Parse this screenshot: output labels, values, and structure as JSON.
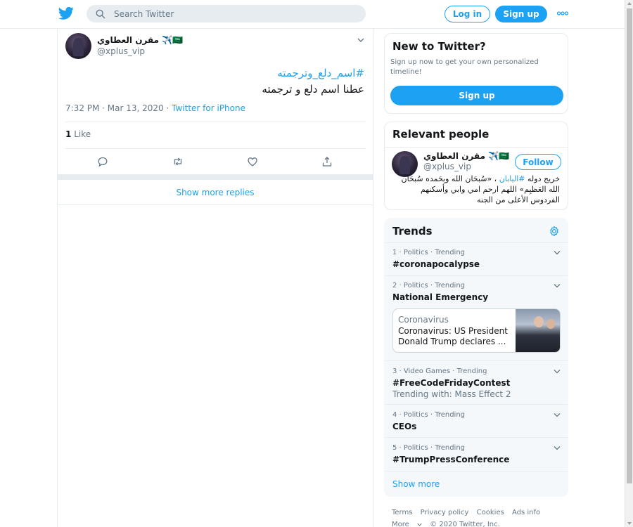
{
  "topbar": {
    "search_placeholder": "Search Twitter",
    "login_label": "Log in",
    "signup_label": "Sign up",
    "logo_icon": "twitter-bird-icon",
    "more_icon": "more-dots-icon"
  },
  "tweet": {
    "author_name": "مقرن العطاوي ✈️🇸🇦",
    "author_handle": "@xplus_vip",
    "hashtag": "#اسم_دلع_وترجمته",
    "text": "عطنا اسم دلع و ترجمته",
    "time": "7:32 PM · Mar 13, 2020",
    "separator": " · ",
    "source": "Twitter for iPhone",
    "likes_count": "1",
    "likes_label": "Like"
  },
  "replies": {
    "show_more_label": "Show more replies"
  },
  "new_to_twitter": {
    "title": "New to Twitter?",
    "subtitle": "Sign up now to get your own personalized timeline!",
    "signup_label": "Sign up"
  },
  "relevant_people": {
    "title": "Relevant people",
    "person": {
      "name": "مقرن العطاوي ✈️🇸🇦",
      "handle": "@xplus_vip",
      "follow_label": "Follow",
      "bio_prefix": "خريج دوله ",
      "bio_tag": "#اليابان",
      "bio_suffix": " ، «سُبحَان الله وبِحَمده سُبحَان الله العَظيِم» اللهم ارحم امي وابي وأسكنهم الفردوس الأعلى من الجنه"
    }
  },
  "trends": {
    "title": "Trends",
    "items": [
      {
        "meta": "1 · Politics · Trending",
        "name": "#coronapocalypse"
      },
      {
        "meta": "2 · Politics · Trending",
        "name": "National Emergency",
        "news": {
          "source": "Coronavirus",
          "headline": "Coronavirus: US President Donald Trump declares ..."
        }
      },
      {
        "meta": "3 · Video Games · Trending",
        "name": "#FreeCodeFridayContest",
        "with": "Trending with: Mass Effect 2"
      },
      {
        "meta": "4 · Politics · Trending",
        "name": "CEOs"
      },
      {
        "meta": "5 · Politics · Trending",
        "name": "#TrumpPressConference"
      }
    ],
    "show_more_label": "Show more"
  },
  "footer": {
    "links": [
      "Terms",
      "Privacy policy",
      "Cookies",
      "Ads info"
    ],
    "more_label": "More",
    "copyright": "© 2020 Twitter, Inc."
  },
  "colors": {
    "accent": "#1da1f2",
    "text": "#14171a",
    "muted": "#657786",
    "border": "#e6ecf0"
  }
}
